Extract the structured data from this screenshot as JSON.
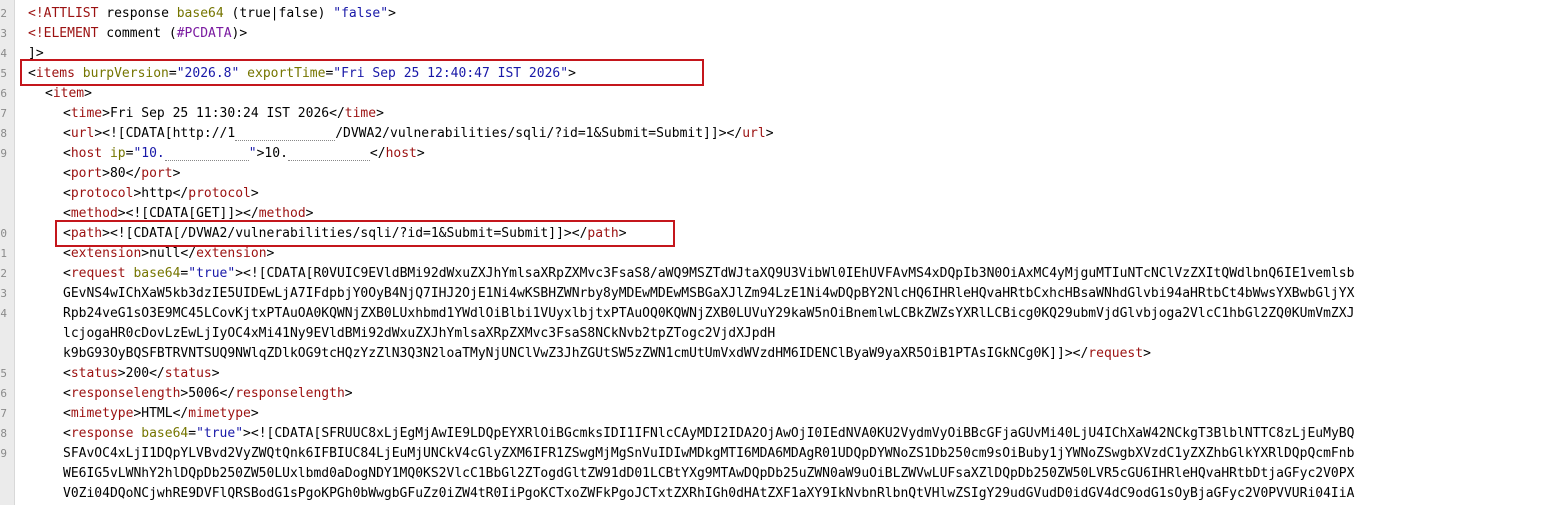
{
  "line_numbers": [
    "2",
    "3",
    "4",
    "5",
    "6",
    "7",
    "8",
    "9",
    "0",
    "1",
    "2",
    "3",
    "4",
    "5",
    "6",
    "7",
    "8",
    "9"
  ],
  "lines": {
    "l1": {
      "p1": "<!ATTLIST",
      "p2": " response ",
      "p3": "base64",
      "p4": " (true|false) ",
      "p5": "\"false\"",
      "p6": ">"
    },
    "l2": {
      "p1": "<!ELEMENT",
      "p2": " comment (",
      "p3": "#PCDATA",
      "p4": ")>"
    },
    "l3": {
      "p1": "]>"
    },
    "l4": {
      "p1": "<",
      "p2": "items",
      "p3": " burpVersion",
      "p4": "=",
      "p5": "\"2026.8\"",
      "p6": " exportTime",
      "p7": "=",
      "p8": "\"Fri Sep 25 12:40:47 IST 2026\"",
      "p9": ">"
    },
    "l5": {
      "p1": "<",
      "p2": "item",
      "p3": ">"
    },
    "l6": {
      "p1": "<",
      "p2": "time",
      "p3": ">Fri Sep 25 11:30:24 IST 2026</",
      "p4": "time",
      "p5": ">"
    },
    "l7": {
      "p1": "<",
      "p2": "url",
      "p3": "><![CDATA[http://1",
      "p4": "/DVWA2/vulnerabilities/sqli/?id=1&Submit=Submit]]></",
      "p5": "url",
      "p6": ">"
    },
    "l8": {
      "p1": "<",
      "p2": "host",
      "p3": " ip",
      "p4": "=",
      "p5": "\"10.",
      "p6": "\"",
      "p7": ">10.",
      "p8": "</",
      "p9": "host",
      "p10": ">"
    },
    "l9": {
      "p1": "<",
      "p2": "port",
      "p3": ">80</",
      "p4": "port",
      "p5": ">"
    },
    "l10": {
      "p1": "<",
      "p2": "protocol",
      "p3": ">http</",
      "p4": "protocol",
      "p5": ">"
    },
    "l11": {
      "p1": "<",
      "p2": "method",
      "p3": "><![CDATA[GET]]></",
      "p4": "method",
      "p5": ">"
    },
    "l12": {
      "p1": "<",
      "p2": "path",
      "p3": "><![CDATA[/DVWA2/vulnerabilities/sqli/?id=1&Submit=Submit]]></",
      "p4": "path",
      "p5": ">"
    },
    "l13": {
      "p1": "<",
      "p2": "extension",
      "p3": ">null</",
      "p4": "extension",
      "p5": ">"
    },
    "l14": {
      "p1": "<",
      "p2": "request",
      "p3": " base64",
      "p4": "=",
      "p5": "\"true\"",
      "p6": "><![CDATA[R0VUIC9EVldBMi92dWxuZXJhYmlsaXRpZXMvc3FsaS8/aWQ9MSZTdWJtaXQ9U3VibWl0IEhUVFAvMS4xDQpIb3N0OiAxMC4yMjguMTIuNTcNClVzZXItQWdlbnQ6IE1vemlsb"
    },
    "l15": {
      "p1": "GEvNS4wIChXaW5kb3dzIE5UIDEwLjA7IFdpbjY0OyB4NjQ7IHJ2OjE1Ni4wKSBHZWNrby8yMDEwMDEwMSBGaXJlZm94LzE1Ni4wDQpBY2NlcHQ6IHRleHQvaHRtbCxhcHBsaWNhdGlvbi94aHRtbCt4bWwsYXBwbGljYX"
    },
    "l16": {
      "p1": "Rpb24veG1sO3E9MC45LCovKjtxPTAuOA0KQWNjZXB0LUxhbmd1YWdlOiBlbi1VUyxlbjtxPTAuOQ0KQWNjZXB0LUVuY29kaW5nOiBnemlwLCBkZWZsYXRlLCBicg0KQ29ubmVjdGlvbjoga2VlcC1hbGl2ZQ0KUmVmZXJ"
    },
    "l17": {
      "p1": "lcjogaHR0cDovLzEwLjIyOC4xMi41Ny9EVldBMi92dWxuZXJhYmlsaXRpZXMvc3FsaS8NCkNvb2tpZTogc2VjdXJpdH"
    },
    "l18": {
      "p1": "k9bG93OyBQSFBTRVNTSUQ9NWlqZDlkOG9tcHQzYzZlN3Q3N2loaTMyNjUNClVwZ3JhZGUtSW5zZWN1cmUtUmVxdWVzdHM6IDENClByaW9yaXR5OiB1PTAsIGkNCg0K]]></",
      "p2": "request",
      "p3": ">"
    },
    "l19": {
      "p1": "<",
      "p2": "status",
      "p3": ">200</",
      "p4": "status",
      "p5": ">"
    },
    "l20": {
      "p1": "<",
      "p2": "responselength",
      "p3": ">5006</",
      "p4": "responselength",
      "p5": ">"
    },
    "l21": {
      "p1": "<",
      "p2": "mimetype",
      "p3": ">HTML</",
      "p4": "mimetype",
      "p5": ">"
    },
    "l22": {
      "p1": "<",
      "p2": "response",
      "p3": " base64",
      "p4": "=",
      "p5": "\"true\"",
      "p6": "><![CDATA[SFRUUC8xLjEgMjAwIE9LDQpEYXRlOiBGcmksIDI1IFNlcCAyMDI2IDA2OjAwOjI0IEdNVA0KU2VydmVyOiBBcGFjaGUvMi40LjU4IChXaW42NCkgT3BlblNTTC8zLjEuMyBQ"
    },
    "l23": {
      "p1": "SFAvOC4xLjI1DQpYLVBvd2VyZWQtQnk6IFBIUC84LjEuMjUNCkV4cGlyZXM6IFR1ZSwgMjMgSnVuIDIwMDkgMTI6MDA6MDAgR01UDQpDYWNoZS1Db250cm9sOiBuby1jYWNoZSwgbXVzdC1yZXZhbGlkYXRlDQpQcmFnb"
    },
    "l24": {
      "p1": "WE6IG5vLWNhY2hlDQpDb250ZW50LUxlbmd0aDogNDY1MQ0KS2VlcC1BbGl2ZTogdGltZW91dD01LCBtYXg9MTAwDQpDb25uZWN0aW9uOiBLZWVwLUFsaXZlDQpDb250ZW50LVR5cGU6IHRleHQvaHRtbDtjaGFyc2V0PX"
    },
    "l25": {
      "p1": "V0Zi04DQoNCjwhRE9DVFlQRSBodG1sPgoKPGh0bWwgbGFuZz0iZW4tR0IiPgoKCTxoZWFkPgoJCTxtZXRhIGh0dHAtZXF1aXY9IkNvbnRlbnQtVHlwZSIgY29udGVudD0idGV4dC9odG1sOyBjaGFyc2V0PVVURi04IiA"
    }
  }
}
